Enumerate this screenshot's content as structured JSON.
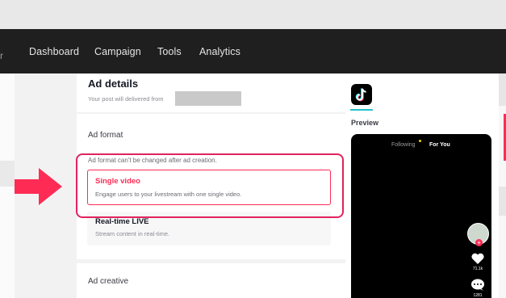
{
  "nav": {
    "edge_glyph": "r",
    "items": [
      "Dashboard",
      "Campaign",
      "Tools",
      "Analytics"
    ]
  },
  "ad_details": {
    "title": "Ad details",
    "subtitle": "Your post will delivered from"
  },
  "ad_format": {
    "title": "Ad format",
    "note": "Ad format can't be changed after ad creation.",
    "options": [
      {
        "label": "Single video",
        "description": "Engage users to your livestream with one single video.",
        "selected": true
      },
      {
        "label": "Real-time LIVE",
        "description": "Stream content in real-time.",
        "selected": false
      }
    ]
  },
  "ad_creative": {
    "title": "Ad creative"
  },
  "preview": {
    "title": "Preview",
    "tabs": [
      "Following",
      "For You"
    ],
    "likes": "71.1k",
    "comments": "1281"
  },
  "colors": {
    "accent": "#fe2c55",
    "highlight": "#e0245e",
    "navbar": "#1f1f1f",
    "teal": "#25c1c8"
  }
}
